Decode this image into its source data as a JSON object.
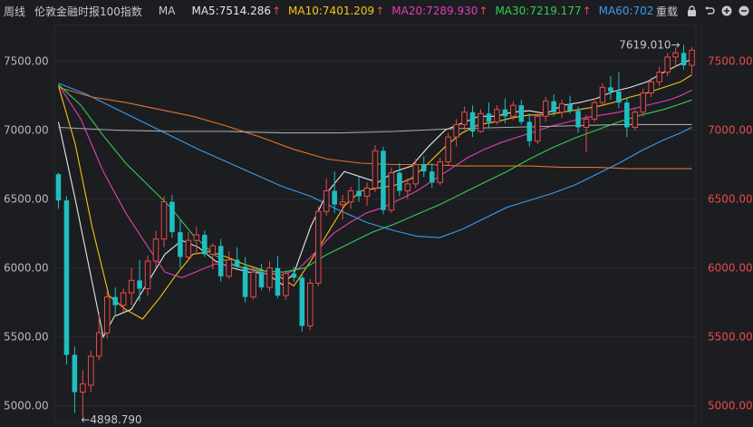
{
  "header": {
    "period_label": "周线",
    "index_name": "伦敦金融时报100指数",
    "ma_label": "MA",
    "ma_items": [
      {
        "label": "MA5:7514.286",
        "color": "#e8e8e8"
      },
      {
        "label": "MA10:7401.209",
        "color": "#f5c518"
      },
      {
        "label": "MA20:7289.930",
        "color": "#e040b0"
      },
      {
        "label": "MA30:7219.177",
        "color": "#2fcf52"
      },
      {
        "label": "MA60:702",
        "color": "#3a9cf0"
      }
    ],
    "up_arrow": "↑",
    "adjust_label": "重载",
    "controls": [
      "lock-icon",
      "undo-icon",
      "zoom-in-icon",
      "zoom-out-icon"
    ]
  },
  "colors": {
    "up": "#e84a4a",
    "down": "#1fbfbf",
    "grid": "#2a2c31",
    "ma120": "#e0742c",
    "ma250": "#a8a8a8"
  },
  "chart_data": {
    "type": "candlestick",
    "title": "伦敦金融时报100指数 周线",
    "y_ticks": [
      "7500.00",
      "7000.00",
      "6500.00",
      "6000.00",
      "5500.00",
      "5000.00"
    ],
    "ylim": [
      4880,
      7720
    ],
    "annotations": [
      {
        "text": "7619.010",
        "value": 7619.01,
        "arrow": "→"
      },
      {
        "text": "4898.790",
        "value": 4898.79,
        "arrow": "←"
      }
    ],
    "ma_lines": [
      {
        "name": "MA5",
        "color": "#e8e8e8",
        "points": [
          [
            0,
            7060
          ],
          [
            3,
            6500
          ],
          [
            6,
            5900
          ],
          [
            8,
            5500
          ],
          [
            10,
            5650
          ],
          [
            13,
            5700
          ],
          [
            16,
            5900
          ],
          [
            19,
            6100
          ],
          [
            22,
            6200
          ],
          [
            25,
            6150
          ],
          [
            28,
            6050
          ],
          [
            31,
            6000
          ],
          [
            34,
            5970
          ],
          [
            37,
            5960
          ],
          [
            40,
            5880
          ],
          [
            42,
            5960
          ],
          [
            45,
            6300
          ],
          [
            48,
            6550
          ],
          [
            51,
            6700
          ],
          [
            54,
            6660
          ],
          [
            57,
            6620
          ],
          [
            60,
            6700
          ],
          [
            63,
            6740
          ],
          [
            66,
            6880
          ],
          [
            69,
            7000
          ],
          [
            72,
            7050
          ],
          [
            75,
            7100
          ],
          [
            78,
            7100
          ],
          [
            81,
            7130
          ],
          [
            84,
            7140
          ],
          [
            87,
            7120
          ],
          [
            90,
            7180
          ],
          [
            93,
            7200
          ],
          [
            96,
            7230
          ],
          [
            99,
            7280
          ],
          [
            102,
            7310
          ],
          [
            105,
            7350
          ],
          [
            108,
            7420
          ],
          [
            111,
            7480
          ],
          [
            113,
            7514
          ]
        ]
      },
      {
        "name": "MA10",
        "color": "#f5c518",
        "points": [
          [
            0,
            7320
          ],
          [
            3,
            6900
          ],
          [
            6,
            6300
          ],
          [
            9,
            5800
          ],
          [
            12,
            5700
          ],
          [
            15,
            5630
          ],
          [
            18,
            5780
          ],
          [
            21,
            5950
          ],
          [
            24,
            6100
          ],
          [
            27,
            6120
          ],
          [
            30,
            6080
          ],
          [
            33,
            6030
          ],
          [
            36,
            5990
          ],
          [
            39,
            5950
          ],
          [
            42,
            5870
          ],
          [
            45,
            6050
          ],
          [
            48,
            6250
          ],
          [
            51,
            6450
          ],
          [
            54,
            6560
          ],
          [
            57,
            6580
          ],
          [
            60,
            6600
          ],
          [
            63,
            6650
          ],
          [
            66,
            6760
          ],
          [
            69,
            6880
          ],
          [
            72,
            6980
          ],
          [
            75,
            7040
          ],
          [
            78,
            7060
          ],
          [
            81,
            7090
          ],
          [
            84,
            7110
          ],
          [
            87,
            7110
          ],
          [
            90,
            7130
          ],
          [
            93,
            7150
          ],
          [
            96,
            7170
          ],
          [
            99,
            7200
          ],
          [
            102,
            7240
          ],
          [
            105,
            7270
          ],
          [
            108,
            7310
          ],
          [
            111,
            7350
          ],
          [
            113,
            7401
          ]
        ]
      },
      {
        "name": "MA20",
        "color": "#e040b0",
        "points": [
          [
            0,
            7330
          ],
          [
            4,
            7080
          ],
          [
            8,
            6700
          ],
          [
            12,
            6400
          ],
          [
            16,
            6150
          ],
          [
            19,
            5970
          ],
          [
            22,
            5930
          ],
          [
            25,
            5980
          ],
          [
            28,
            6030
          ],
          [
            31,
            6020
          ],
          [
            34,
            5990
          ],
          [
            37,
            5960
          ],
          [
            40,
            5950
          ],
          [
            43,
            6000
          ],
          [
            46,
            6120
          ],
          [
            49,
            6250
          ],
          [
            52,
            6330
          ],
          [
            55,
            6400
          ],
          [
            58,
            6440
          ],
          [
            61,
            6500
          ],
          [
            64,
            6560
          ],
          [
            67,
            6640
          ],
          [
            70,
            6720
          ],
          [
            73,
            6800
          ],
          [
            76,
            6860
          ],
          [
            79,
            6910
          ],
          [
            82,
            6950
          ],
          [
            85,
            6990
          ],
          [
            88,
            7030
          ],
          [
            91,
            7060
          ],
          [
            94,
            7090
          ],
          [
            97,
            7110
          ],
          [
            100,
            7130
          ],
          [
            103,
            7160
          ],
          [
            106,
            7190
          ],
          [
            109,
            7220
          ],
          [
            111,
            7250
          ],
          [
            113,
            7290
          ]
        ]
      },
      {
        "name": "MA30",
        "color": "#2fcf52",
        "points": [
          [
            0,
            7330
          ],
          [
            4,
            7180
          ],
          [
            8,
            6960
          ],
          [
            12,
            6760
          ],
          [
            16,
            6600
          ],
          [
            20,
            6440
          ],
          [
            24,
            6240
          ],
          [
            28,
            6090
          ],
          [
            32,
            6010
          ],
          [
            36,
            5980
          ],
          [
            40,
            5970
          ],
          [
            44,
            6000
          ],
          [
            48,
            6100
          ],
          [
            52,
            6180
          ],
          [
            56,
            6260
          ],
          [
            60,
            6320
          ],
          [
            64,
            6390
          ],
          [
            68,
            6460
          ],
          [
            72,
            6540
          ],
          [
            76,
            6620
          ],
          [
            80,
            6700
          ],
          [
            84,
            6790
          ],
          [
            88,
            6870
          ],
          [
            92,
            6940
          ],
          [
            96,
            7000
          ],
          [
            100,
            7060
          ],
          [
            104,
            7110
          ],
          [
            108,
            7150
          ],
          [
            111,
            7190
          ],
          [
            113,
            7219
          ]
        ]
      },
      {
        "name": "MA60",
        "color": "#3a9cf0",
        "points": [
          [
            0,
            7340
          ],
          [
            5,
            7260
          ],
          [
            10,
            7160
          ],
          [
            15,
            7060
          ],
          [
            20,
            6960
          ],
          [
            25,
            6860
          ],
          [
            30,
            6770
          ],
          [
            35,
            6680
          ],
          [
            40,
            6590
          ],
          [
            45,
            6520
          ],
          [
            50,
            6420
          ],
          [
            55,
            6330
          ],
          [
            60,
            6270
          ],
          [
            64,
            6230
          ],
          [
            68,
            6220
          ],
          [
            72,
            6280
          ],
          [
            76,
            6360
          ],
          [
            80,
            6440
          ],
          [
            84,
            6490
          ],
          [
            88,
            6540
          ],
          [
            92,
            6600
          ],
          [
            96,
            6680
          ],
          [
            100,
            6760
          ],
          [
            104,
            6850
          ],
          [
            108,
            6930
          ],
          [
            111,
            6980
          ],
          [
            113,
            7020
          ]
        ]
      },
      {
        "name": "MA120",
        "color": "#e0742c",
        "points": [
          [
            0,
            7310
          ],
          [
            6,
            7240
          ],
          [
            12,
            7200
          ],
          [
            18,
            7150
          ],
          [
            24,
            7100
          ],
          [
            30,
            7030
          ],
          [
            36,
            6950
          ],
          [
            42,
            6860
          ],
          [
            48,
            6790
          ],
          [
            54,
            6760
          ],
          [
            60,
            6750
          ],
          [
            66,
            6750
          ],
          [
            72,
            6740
          ],
          [
            78,
            6740
          ],
          [
            84,
            6740
          ],
          [
            90,
            6730
          ],
          [
            96,
            6730
          ],
          [
            102,
            6720
          ],
          [
            108,
            6720
          ],
          [
            113,
            6720
          ]
        ]
      },
      {
        "name": "MA250",
        "color": "#a8a8a8",
        "points": [
          [
            0,
            7020
          ],
          [
            10,
            7000
          ],
          [
            20,
            6990
          ],
          [
            30,
            6990
          ],
          [
            40,
            6980
          ],
          [
            50,
            6980
          ],
          [
            60,
            6990
          ],
          [
            70,
            7010
          ],
          [
            80,
            7020
          ],
          [
            90,
            7030
          ],
          [
            100,
            7040
          ],
          [
            110,
            7040
          ],
          [
            113,
            7040
          ]
        ]
      }
    ],
    "ohlc": [
      [
        6680,
        6690,
        6430,
        6490
      ],
      [
        6490,
        6520,
        5300,
        5370
      ],
      [
        5370,
        5430,
        4950,
        5100
      ],
      [
        5100,
        5260,
        4899,
        5160
      ],
      [
        5150,
        5400,
        5100,
        5360
      ],
      [
        5360,
        5680,
        5330,
        5530
      ],
      [
        5530,
        5840,
        5490,
        5790
      ],
      [
        5790,
        5860,
        5650,
        5730
      ],
      [
        5730,
        5850,
        5680,
        5820
      ],
      [
        5820,
        6000,
        5730,
        5910
      ],
      [
        5910,
        6060,
        5760,
        5850
      ],
      [
        5850,
        6090,
        5800,
        6050
      ],
      [
        6050,
        6270,
        6000,
        6210
      ],
      [
        6210,
        6520,
        6150,
        6480
      ],
      [
        6480,
        6530,
        6220,
        6260
      ],
      [
        6260,
        6350,
        6000,
        6080
      ],
      [
        6080,
        6260,
        6050,
        6200
      ],
      [
        6200,
        6300,
        6100,
        6240
      ],
      [
        6240,
        6270,
        6080,
        6100
      ],
      [
        6100,
        6180,
        5990,
        6160
      ],
      [
        6160,
        6210,
        5900,
        5940
      ],
      [
        5940,
        6120,
        5920,
        6060
      ],
      [
        6060,
        6150,
        5990,
        6010
      ],
      [
        6010,
        6080,
        5750,
        5790
      ],
      [
        5790,
        6000,
        5770,
        5970
      ],
      [
        5970,
        6030,
        5840,
        5860
      ],
      [
        5860,
        6050,
        5830,
        6000
      ],
      [
        6000,
        6090,
        5780,
        5800
      ],
      [
        5800,
        5980,
        5770,
        5960
      ],
      [
        5960,
        6010,
        5900,
        5930
      ],
      [
        5930,
        5950,
        5540,
        5580
      ],
      [
        5580,
        5920,
        5550,
        5890
      ],
      [
        5890,
        6450,
        5870,
        6410
      ],
      [
        6410,
        6650,
        6380,
        6560
      ],
      [
        6560,
        6700,
        6400,
        6460
      ],
      [
        6460,
        6530,
        6350,
        6480
      ],
      [
        6480,
        6590,
        6430,
        6560
      ],
      [
        6560,
        6660,
        6480,
        6520
      ],
      [
        6520,
        6620,
        6450,
        6580
      ],
      [
        6580,
        6890,
        6550,
        6850
      ],
      [
        6850,
        6880,
        6390,
        6420
      ],
      [
        6420,
        6730,
        6400,
        6690
      ],
      [
        6690,
        6760,
        6520,
        6560
      ],
      [
        6560,
        6650,
        6500,
        6610
      ],
      [
        6610,
        6790,
        6580,
        6750
      ],
      [
        6750,
        6810,
        6660,
        6700
      ],
      [
        6700,
        6760,
        6580,
        6620
      ],
      [
        6620,
        6800,
        6600,
        6770
      ],
      [
        6770,
        6980,
        6740,
        6950
      ],
      [
        6950,
        7080,
        6880,
        7040
      ],
      [
        7040,
        7170,
        7000,
        7130
      ],
      [
        7130,
        7180,
        6950,
        6990
      ],
      [
        6990,
        7150,
        6980,
        7120
      ],
      [
        7120,
        7200,
        7020,
        7060
      ],
      [
        7060,
        7180,
        7040,
        7150
      ],
      [
        7150,
        7230,
        7050,
        7100
      ],
      [
        7100,
        7210,
        7070,
        7180
      ],
      [
        7180,
        7220,
        7040,
        7060
      ],
      [
        7060,
        7120,
        6880,
        6920
      ],
      [
        6920,
        7120,
        6900,
        7100
      ],
      [
        7100,
        7240,
        7060,
        7210
      ],
      [
        7210,
        7260,
        7100,
        7130
      ],
      [
        7130,
        7220,
        7090,
        7190
      ],
      [
        7190,
        7250,
        7120,
        7140
      ],
      [
        7140,
        7170,
        6980,
        7020
      ],
      [
        7020,
        7110,
        6840,
        7080
      ],
      [
        7080,
        7230,
        7060,
        7200
      ],
      [
        7200,
        7340,
        7180,
        7310
      ],
      [
        7310,
        7390,
        7220,
        7280
      ],
      [
        7280,
        7420,
        7160,
        7200
      ],
      [
        7200,
        7240,
        6950,
        7020
      ],
      [
        7020,
        7150,
        7000,
        7130
      ],
      [
        7130,
        7300,
        7100,
        7270
      ],
      [
        7270,
        7380,
        7240,
        7350
      ],
      [
        7350,
        7460,
        7320,
        7420
      ],
      [
        7420,
        7560,
        7390,
        7530
      ],
      [
        7530,
        7600,
        7460,
        7560
      ],
      [
        7560,
        7619,
        7440,
        7470
      ],
      [
        7470,
        7600,
        7410,
        7580
      ]
    ]
  }
}
